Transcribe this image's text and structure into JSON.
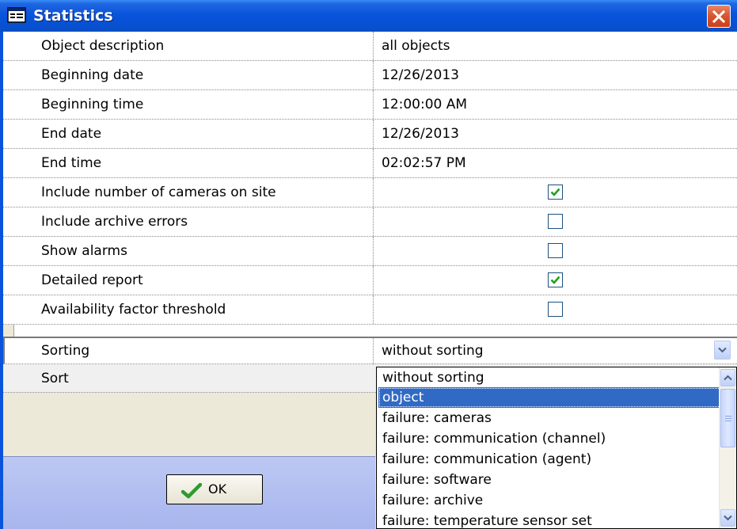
{
  "window": {
    "title": "Statistics",
    "title_icon": "window-icon",
    "close_icon": "close-icon"
  },
  "properties": [
    {
      "label": "Object description",
      "value": "all objects"
    },
    {
      "label": "Beginning date",
      "value": "12/26/2013"
    },
    {
      "label": "Beginning time",
      "value": "12:00:00 AM"
    },
    {
      "label": "End date",
      "value": "12/26/2013"
    },
    {
      "label": "End time",
      "value": "02:02:57 PM"
    },
    {
      "label": "Include number of cameras on site",
      "checked": true
    },
    {
      "label": "Include archive errors",
      "checked": false
    },
    {
      "label": "Show alarms",
      "checked": false
    },
    {
      "label": "Detailed report",
      "checked": true
    },
    {
      "label": "Availability factor threshold",
      "checked": false
    }
  ],
  "sorting": {
    "label": "Sorting",
    "value": "without sorting",
    "options": [
      "without sorting",
      "object",
      "failure: cameras",
      "failure: communication (channel)",
      "failure: communication (agent)",
      "failure: software",
      "failure: archive",
      "failure: temperature sensor set"
    ],
    "highlighted": "object"
  },
  "sort": {
    "label": "Sort"
  },
  "buttons": {
    "ok_label": "OK"
  },
  "colors": {
    "titlebar": "#0a54dc",
    "selection": "#316ac5",
    "checkmark": "#21a121",
    "dialog_bg": "#ece9d8"
  }
}
